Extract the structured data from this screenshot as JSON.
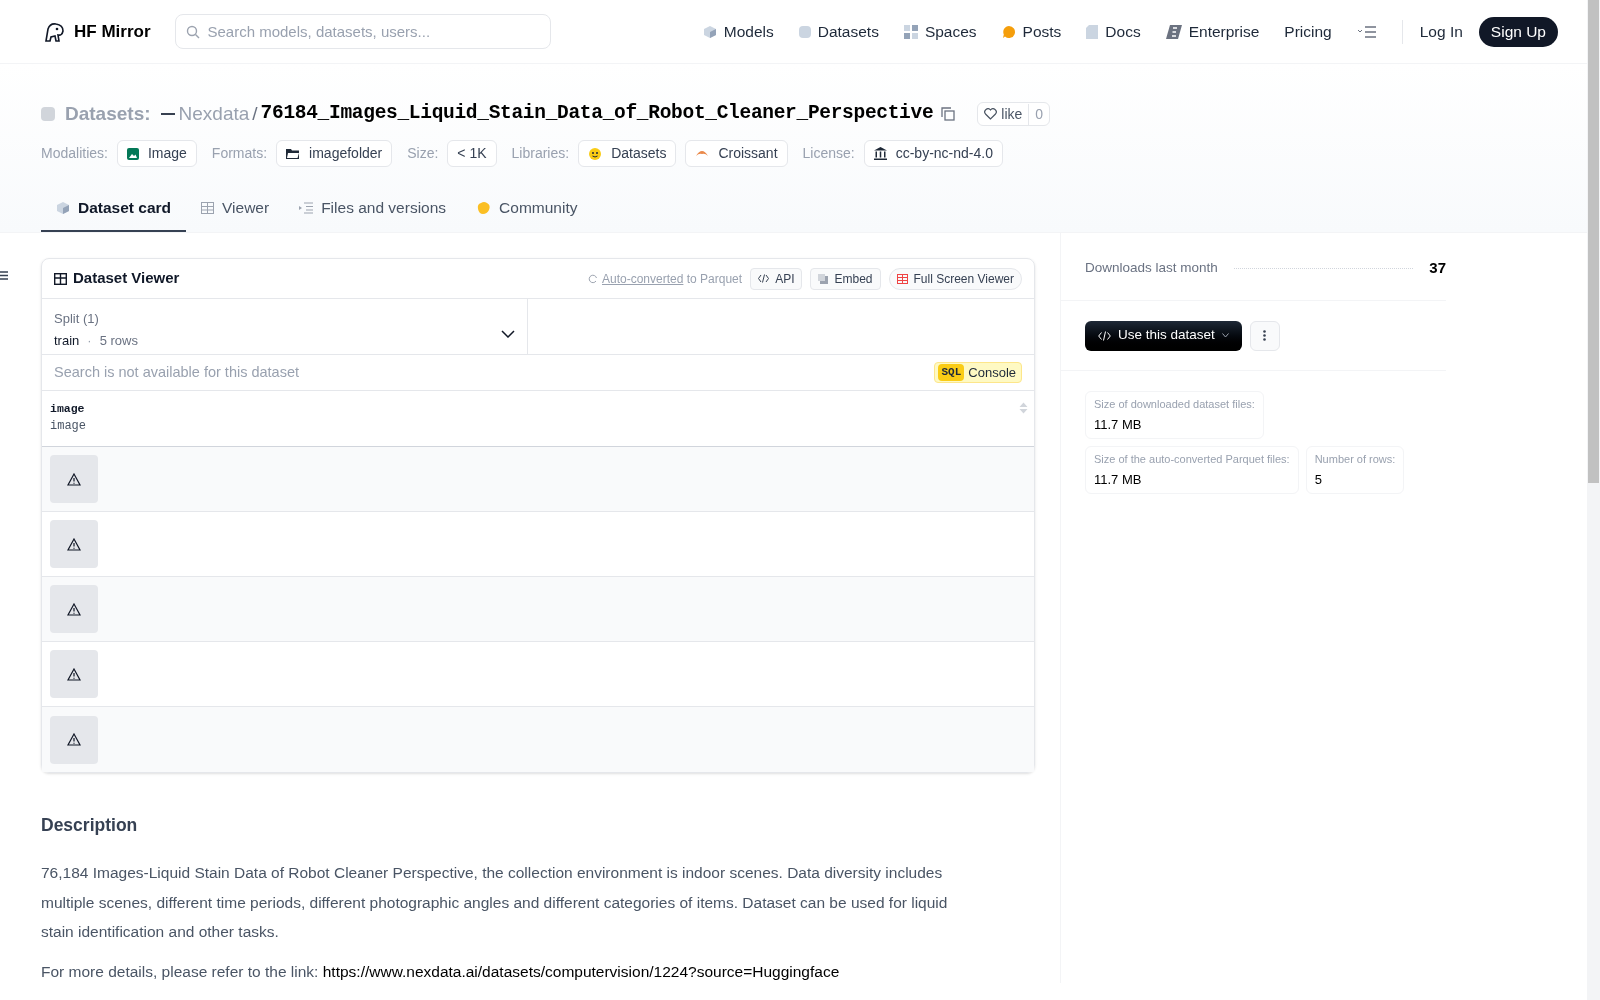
{
  "nav": {
    "brand": "HF Mirror",
    "search_placeholder": "Search models, datasets, users...",
    "links": [
      {
        "label": "Models"
      },
      {
        "label": "Datasets"
      },
      {
        "label": "Spaces"
      },
      {
        "label": "Posts"
      },
      {
        "label": "Docs"
      },
      {
        "label": "Enterprise"
      },
      {
        "label": "Pricing"
      }
    ],
    "login": "Log In",
    "signup": "Sign Up"
  },
  "header": {
    "section": "Datasets:",
    "owner": "Nexdata",
    "separator": "/",
    "name": "76184_Images_Liquid_Stain_Data_of_Robot_Cleaner_Perspective",
    "like": "like",
    "likes": "0",
    "tags": [
      {
        "label": "Modalities:",
        "values": [
          "Image"
        ]
      },
      {
        "label": "Formats:",
        "values": [
          "imagefolder"
        ]
      },
      {
        "label": "Size:",
        "values": [
          "< 1K"
        ]
      },
      {
        "label": "Libraries:",
        "values": [
          "Datasets",
          "Croissant"
        ]
      },
      {
        "label": "License:",
        "values": [
          "cc-by-nc-nd-4.0"
        ]
      }
    ]
  },
  "tabs": [
    {
      "label": "Dataset card",
      "selected": true
    },
    {
      "label": "Viewer",
      "selected": false
    },
    {
      "label": "Files and versions",
      "selected": false
    },
    {
      "label": "Community",
      "selected": false
    }
  ],
  "viewer": {
    "title": "Dataset Viewer",
    "auto_link": "Auto-converted",
    "auto_rest": "to Parquet",
    "buttons": [
      "API",
      "Embed",
      "Full Screen Viewer"
    ],
    "split_label": "Split (1)",
    "split_name": "train",
    "split_sep": "·",
    "split_rows": "5 rows",
    "search_placeholder": "Search is not available for this dataset",
    "sql_badge": "SQL",
    "sql_label": "Console",
    "column": {
      "name": "image",
      "type": "image"
    },
    "rows": [
      {
        "kind": "broken_image"
      },
      {
        "kind": "broken_image"
      },
      {
        "kind": "broken_image"
      },
      {
        "kind": "broken_image"
      },
      {
        "kind": "broken_image"
      }
    ]
  },
  "description": {
    "heading": "Description",
    "paragraph": "76,184 Images-Liquid Stain Data of Robot Cleaner Perspective, the collection environment is indoor scenes. Data diversity includes multiple scenes, different time periods, different photographic angles and different categories of items. Dataset can be used for liquid stain identification and other tasks.",
    "more_prefix": "For more details, please refer to the link:",
    "more_link": "https://www.nexdata.ai/datasets/computervision/1224?source=Huggingface"
  },
  "sidebar": {
    "downloads_label": "Downloads last month",
    "downloads": "37",
    "use_button": "Use this dataset",
    "stats": [
      {
        "label": "Size of downloaded dataset files:",
        "value": "11.7 MB"
      },
      {
        "label": "Size of the auto-converted Parquet files:",
        "value": "11.7 MB"
      },
      {
        "label": "Number of rows:",
        "value": "5"
      }
    ]
  }
}
